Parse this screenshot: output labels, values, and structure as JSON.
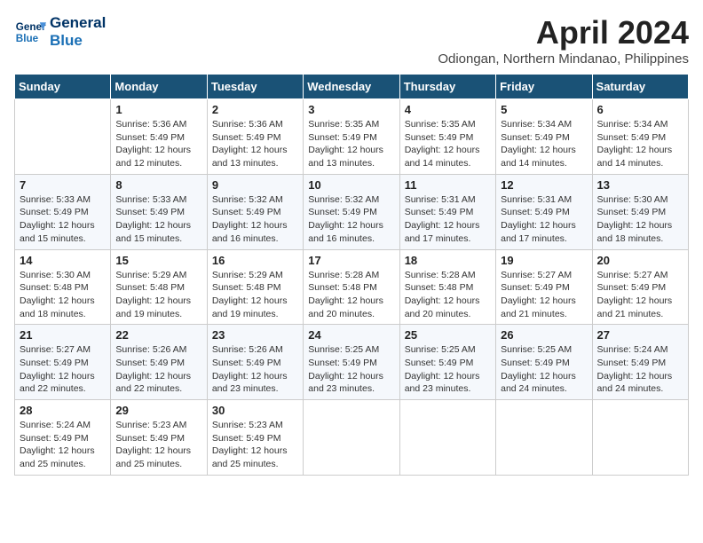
{
  "logo": {
    "line1": "General",
    "line2": "Blue"
  },
  "title": "April 2024",
  "subtitle": "Odiongan, Northern Mindanao, Philippines",
  "days_header": [
    "Sunday",
    "Monday",
    "Tuesday",
    "Wednesday",
    "Thursday",
    "Friday",
    "Saturday"
  ],
  "weeks": [
    [
      {
        "day": "",
        "info": ""
      },
      {
        "day": "1",
        "info": "Sunrise: 5:36 AM\nSunset: 5:49 PM\nDaylight: 12 hours\nand 12 minutes."
      },
      {
        "day": "2",
        "info": "Sunrise: 5:36 AM\nSunset: 5:49 PM\nDaylight: 12 hours\nand 13 minutes."
      },
      {
        "day": "3",
        "info": "Sunrise: 5:35 AM\nSunset: 5:49 PM\nDaylight: 12 hours\nand 13 minutes."
      },
      {
        "day": "4",
        "info": "Sunrise: 5:35 AM\nSunset: 5:49 PM\nDaylight: 12 hours\nand 14 minutes."
      },
      {
        "day": "5",
        "info": "Sunrise: 5:34 AM\nSunset: 5:49 PM\nDaylight: 12 hours\nand 14 minutes."
      },
      {
        "day": "6",
        "info": "Sunrise: 5:34 AM\nSunset: 5:49 PM\nDaylight: 12 hours\nand 14 minutes."
      }
    ],
    [
      {
        "day": "7",
        "info": "Sunrise: 5:33 AM\nSunset: 5:49 PM\nDaylight: 12 hours\nand 15 minutes."
      },
      {
        "day": "8",
        "info": "Sunrise: 5:33 AM\nSunset: 5:49 PM\nDaylight: 12 hours\nand 15 minutes."
      },
      {
        "day": "9",
        "info": "Sunrise: 5:32 AM\nSunset: 5:49 PM\nDaylight: 12 hours\nand 16 minutes."
      },
      {
        "day": "10",
        "info": "Sunrise: 5:32 AM\nSunset: 5:49 PM\nDaylight: 12 hours\nand 16 minutes."
      },
      {
        "day": "11",
        "info": "Sunrise: 5:31 AM\nSunset: 5:49 PM\nDaylight: 12 hours\nand 17 minutes."
      },
      {
        "day": "12",
        "info": "Sunrise: 5:31 AM\nSunset: 5:49 PM\nDaylight: 12 hours\nand 17 minutes."
      },
      {
        "day": "13",
        "info": "Sunrise: 5:30 AM\nSunset: 5:49 PM\nDaylight: 12 hours\nand 18 minutes."
      }
    ],
    [
      {
        "day": "14",
        "info": "Sunrise: 5:30 AM\nSunset: 5:48 PM\nDaylight: 12 hours\nand 18 minutes."
      },
      {
        "day": "15",
        "info": "Sunrise: 5:29 AM\nSunset: 5:48 PM\nDaylight: 12 hours\nand 19 minutes."
      },
      {
        "day": "16",
        "info": "Sunrise: 5:29 AM\nSunset: 5:48 PM\nDaylight: 12 hours\nand 19 minutes."
      },
      {
        "day": "17",
        "info": "Sunrise: 5:28 AM\nSunset: 5:48 PM\nDaylight: 12 hours\nand 20 minutes."
      },
      {
        "day": "18",
        "info": "Sunrise: 5:28 AM\nSunset: 5:48 PM\nDaylight: 12 hours\nand 20 minutes."
      },
      {
        "day": "19",
        "info": "Sunrise: 5:27 AM\nSunset: 5:49 PM\nDaylight: 12 hours\nand 21 minutes."
      },
      {
        "day": "20",
        "info": "Sunrise: 5:27 AM\nSunset: 5:49 PM\nDaylight: 12 hours\nand 21 minutes."
      }
    ],
    [
      {
        "day": "21",
        "info": "Sunrise: 5:27 AM\nSunset: 5:49 PM\nDaylight: 12 hours\nand 22 minutes."
      },
      {
        "day": "22",
        "info": "Sunrise: 5:26 AM\nSunset: 5:49 PM\nDaylight: 12 hours\nand 22 minutes."
      },
      {
        "day": "23",
        "info": "Sunrise: 5:26 AM\nSunset: 5:49 PM\nDaylight: 12 hours\nand 23 minutes."
      },
      {
        "day": "24",
        "info": "Sunrise: 5:25 AM\nSunset: 5:49 PM\nDaylight: 12 hours\nand 23 minutes."
      },
      {
        "day": "25",
        "info": "Sunrise: 5:25 AM\nSunset: 5:49 PM\nDaylight: 12 hours\nand 23 minutes."
      },
      {
        "day": "26",
        "info": "Sunrise: 5:25 AM\nSunset: 5:49 PM\nDaylight: 12 hours\nand 24 minutes."
      },
      {
        "day": "27",
        "info": "Sunrise: 5:24 AM\nSunset: 5:49 PM\nDaylight: 12 hours\nand 24 minutes."
      }
    ],
    [
      {
        "day": "28",
        "info": "Sunrise: 5:24 AM\nSunset: 5:49 PM\nDaylight: 12 hours\nand 25 minutes."
      },
      {
        "day": "29",
        "info": "Sunrise: 5:23 AM\nSunset: 5:49 PM\nDaylight: 12 hours\nand 25 minutes."
      },
      {
        "day": "30",
        "info": "Sunrise: 5:23 AM\nSunset: 5:49 PM\nDaylight: 12 hours\nand 25 minutes."
      },
      {
        "day": "",
        "info": ""
      },
      {
        "day": "",
        "info": ""
      },
      {
        "day": "",
        "info": ""
      },
      {
        "day": "",
        "info": ""
      }
    ]
  ]
}
